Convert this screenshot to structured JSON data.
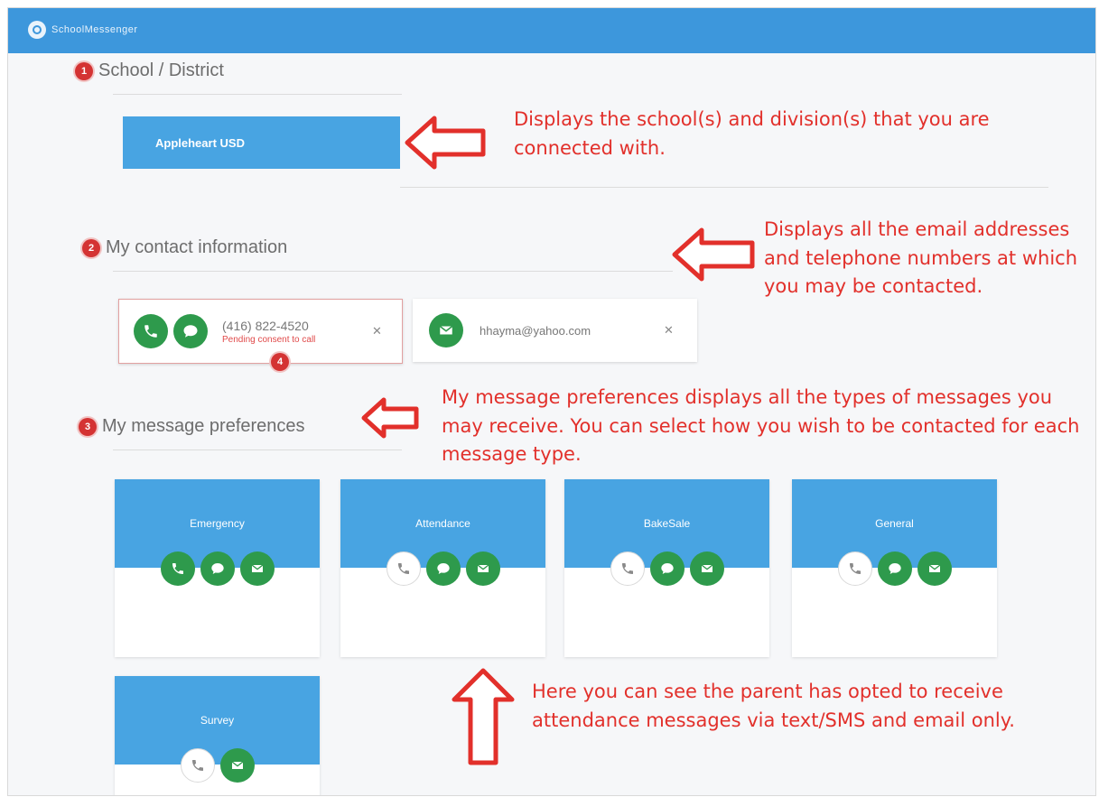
{
  "app": {
    "logo_text": "SchoolMessenger"
  },
  "sections": {
    "district": {
      "number": "1",
      "title": "School / District",
      "item": "Appleheart USD"
    },
    "contact": {
      "number": "2",
      "title": "My contact information",
      "phone": "(416) 822-4520",
      "phone_status": "Pending consent to call",
      "phone_badge": "4",
      "email": "hhayma@yahoo.com"
    },
    "prefs": {
      "number": "3",
      "title": "My message preferences",
      "cards": [
        {
          "label": "Emergency",
          "phone": true,
          "sms": true,
          "email": true
        },
        {
          "label": "Attendance",
          "phone": false,
          "sms": true,
          "email": true
        },
        {
          "label": "BakeSale",
          "phone": false,
          "sms": true,
          "email": true
        },
        {
          "label": "General",
          "phone": false,
          "sms": true,
          "email": true
        },
        {
          "label": "Survey",
          "phone": false,
          "email": true
        }
      ]
    }
  },
  "annotations": {
    "district": "Displays the school(s) and division(s) that you are connected with.",
    "contact": "Displays all the email addresses and telephone numbers at which you may be contacted.",
    "prefs": "My message preferences displays all the types of messages you may receive. You can select how you wish to be contacted for each message type.",
    "example": "Here you can see the parent has opted to receive attendance messages via text/SMS and email only."
  },
  "colors": {
    "header": "#3d97dc",
    "card": "#48a4e2",
    "on": "#2e9a4c",
    "annotation": "#e2302b",
    "number": "#d43333"
  },
  "icons": [
    "phone-icon",
    "chat-icon",
    "email-icon",
    "close-icon",
    "arrow-left-icon",
    "arrow-up-icon"
  ]
}
